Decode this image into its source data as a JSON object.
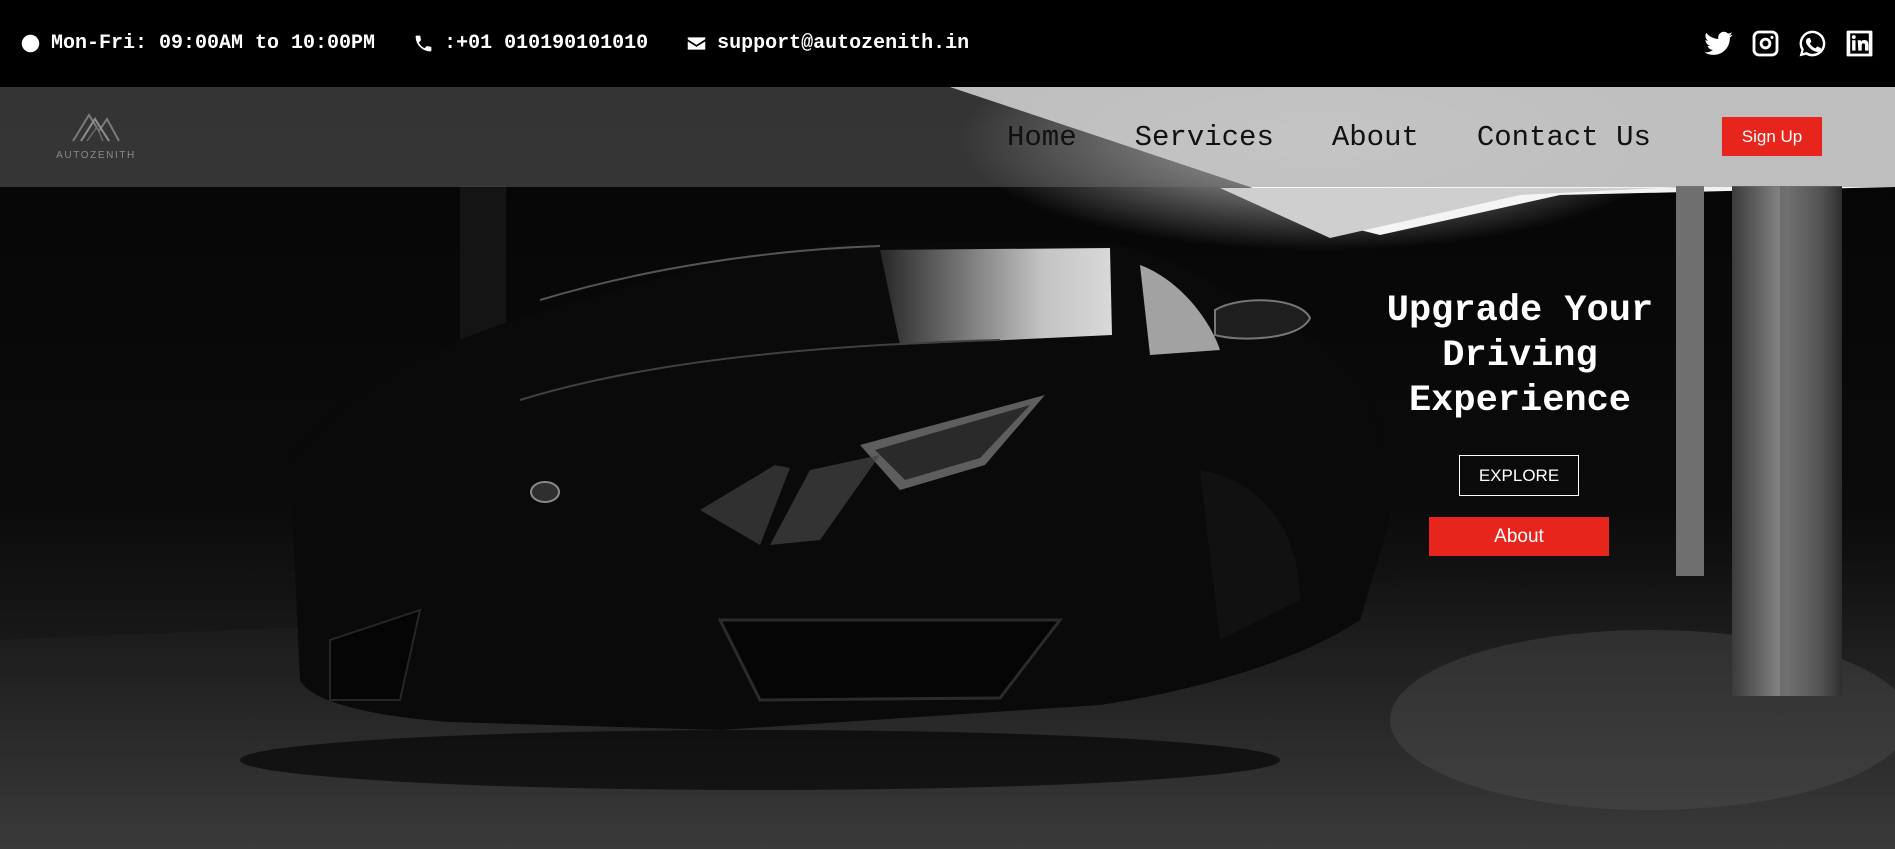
{
  "topbar": {
    "hours": {
      "icon": "clock-icon",
      "text": "Mon-Fri: 09:00AM to 10:00PM"
    },
    "phone": {
      "icon": "phone-icon",
      "text": ":+01 010190101010"
    },
    "email": {
      "icon": "envelope-icon",
      "text": "support@autozenith.in"
    },
    "social": [
      "twitter-icon",
      "instagram-icon",
      "whatsapp-icon",
      "linkedin-icon"
    ]
  },
  "brand": {
    "name": "AUTOZENITH"
  },
  "nav": {
    "links": [
      "Home",
      "Services",
      "About",
      "Contact Us"
    ],
    "signup": "Sign Up"
  },
  "hero": {
    "headline": "Upgrade Your Driving Experience",
    "explore": "EXPLORE",
    "about": "About"
  },
  "colors": {
    "accent": "#e8251c",
    "topbar": "#000000",
    "text": "#ffffff"
  }
}
